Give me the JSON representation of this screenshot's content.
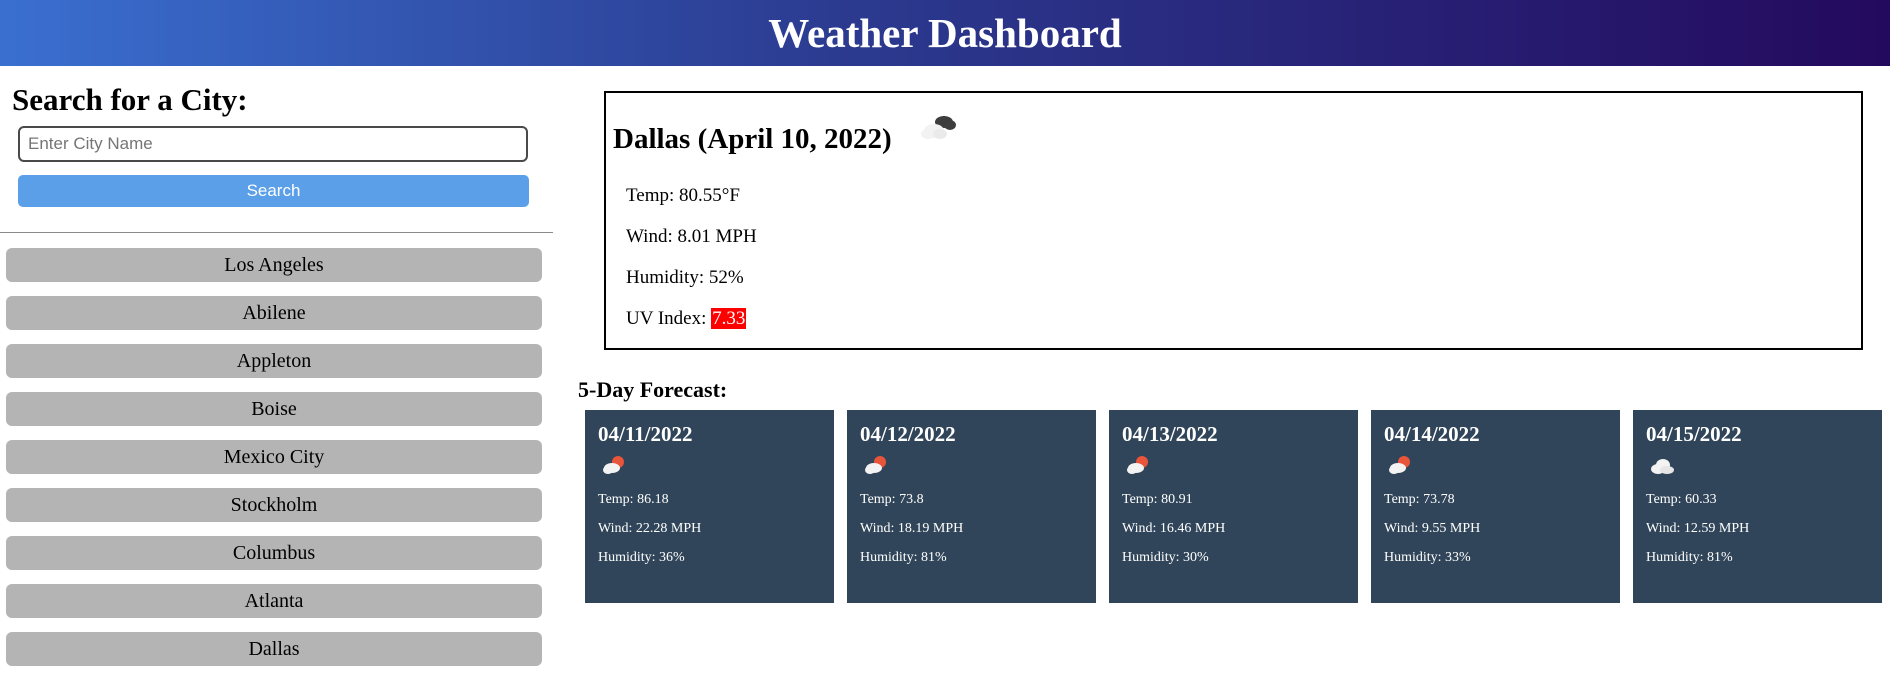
{
  "header": {
    "title": "Weather Dashboard"
  },
  "search": {
    "title": "Search for a City:",
    "placeholder": "Enter City Name",
    "value": "",
    "button_label": "Search"
  },
  "history": [
    "Los Angeles",
    "Abilene",
    "Appleton",
    "Boise",
    "Mexico City",
    "Stockholm",
    "Columbus",
    "Atlanta",
    "Dallas"
  ],
  "current": {
    "heading": "Dallas (April 10, 2022)",
    "icon": "broken-clouds-icon",
    "temp": "Temp: 80.55°F",
    "wind": "Wind: 8.01 MPH",
    "humidity": "Humidity: 52%",
    "uv_label": "UV Index:",
    "uv_value": "7.33",
    "uv_color": "#ff0000"
  },
  "forecast": {
    "title": "5-Day Forecast:",
    "days": [
      {
        "date": "04/11/2022",
        "icon": "few-clouds-day-icon",
        "temp": "Temp: 86.18",
        "wind": "Wind: 22.28 MPH",
        "humidity": "Humidity: 36%"
      },
      {
        "date": "04/12/2022",
        "icon": "few-clouds-day-icon",
        "temp": "Temp: 73.8",
        "wind": "Wind: 18.19 MPH",
        "humidity": "Humidity: 81%"
      },
      {
        "date": "04/13/2022",
        "icon": "few-clouds-day-icon",
        "temp": "Temp: 80.91",
        "wind": "Wind: 16.46 MPH",
        "humidity": "Humidity: 30%"
      },
      {
        "date": "04/14/2022",
        "icon": "few-clouds-day-icon",
        "temp": "Temp: 73.78",
        "wind": "Wind: 9.55 MPH",
        "humidity": "Humidity: 33%"
      },
      {
        "date": "04/15/2022",
        "icon": "cloud-icon",
        "temp": "Temp: 60.33",
        "wind": "Wind: 12.59 MPH",
        "humidity": "Humidity: 81%"
      }
    ]
  },
  "colors": {
    "header_gradient_start": "#3a6fd0",
    "header_gradient_end": "#240a5e",
    "search_button": "#5a9fe8",
    "history_button": "#b4b4b4",
    "forecast_card": "#304559"
  }
}
